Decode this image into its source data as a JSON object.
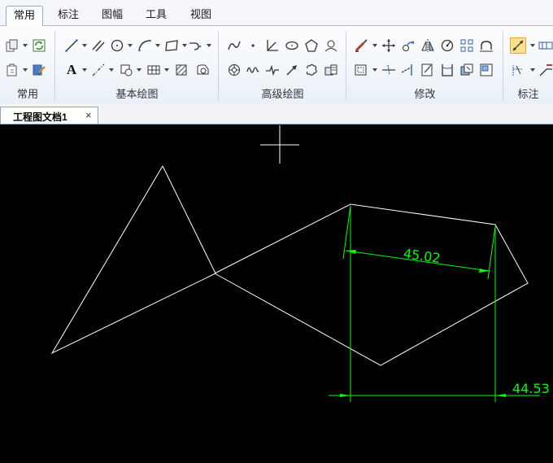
{
  "menu": {
    "tabs": [
      "常用",
      "标注",
      "图幅",
      "工具",
      "视图"
    ],
    "active": "常用"
  },
  "ribbon": {
    "groups": [
      "常用",
      "基本绘图",
      "高级绘图",
      "修改",
      "标注"
    ],
    "text_tool_label": "A"
  },
  "document": {
    "tab_title": "工程图文档1",
    "close_glyph": "×"
  },
  "drawing": {
    "colors": {
      "geometry": "#ffffff",
      "dimension": "#00ff00",
      "background": "#000000"
    },
    "dimensions": [
      "45.02",
      "44.53"
    ]
  }
}
